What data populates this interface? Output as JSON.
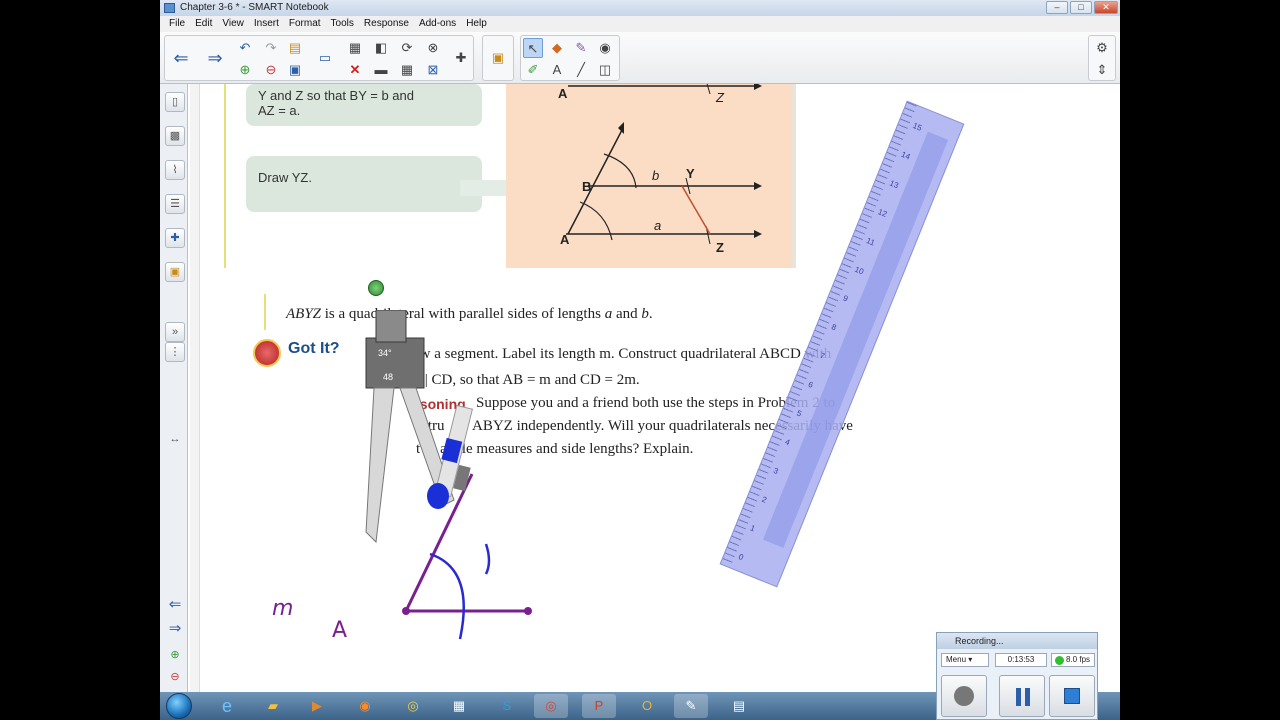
{
  "window": {
    "title": "Chapter 3-6 * - SMART Notebook",
    "menu": [
      "File",
      "Edit",
      "View",
      "Insert",
      "Format",
      "Tools",
      "Response",
      "Add-ons",
      "Help"
    ]
  },
  "page": {
    "step1_text": "Y and Z so that BY = b and",
    "step1_text2": "AZ = a.",
    "step2_text": "Draw YZ.",
    "fig_labels": {
      "A_top": "A",
      "Z_top": "Z",
      "B": "B",
      "b": "b",
      "Y": "Y",
      "A": "A",
      "a": "a",
      "Z": "Z"
    },
    "statement_italic": "ABYZ",
    "statement_rest": " is a quadrilateral with parallel sides of lengths ",
    "statement_a": "a",
    "statement_and": " and ",
    "statement_b": "b",
    "statement_end": ".",
    "gotit": "Got It?",
    "q1_line1": "raw a segment. Label its length m. Construct quadrilateral ABCD with",
    "q1_line2": "B || CD, so that AB = m and CD = 2m.",
    "q2_word": "asoning",
    "q2_line1": " Suppose you and a friend both use the steps in Problem 2 to",
    "q2_line2a": "stru",
    "q2_line2b": " ABYZ independently. Will your quadrilaterals necessarily have",
    "q2_line3": "t  sa  angle measures and side lengths? Explain.",
    "compass_angle": "34°",
    "compass_value": "48",
    "handwriting_m": "m",
    "handwriting_A": "A"
  },
  "ruler": {
    "numbers": [
      "15",
      "14",
      "13",
      "12",
      "11",
      "10",
      "9",
      "8",
      "7",
      "6",
      "5",
      "4",
      "3",
      "2",
      "1",
      "0"
    ]
  },
  "recorder": {
    "title": "Recording...",
    "menu_label": "Menu",
    "time": "0:13:53",
    "fps": "8.0 fps"
  },
  "colors": {
    "accent": "#1b4e8a",
    "peach": "#fbdcc4",
    "green_box": "#dbe7dd",
    "ruler": "#a8aff0",
    "ink": "#7a1f8f"
  }
}
